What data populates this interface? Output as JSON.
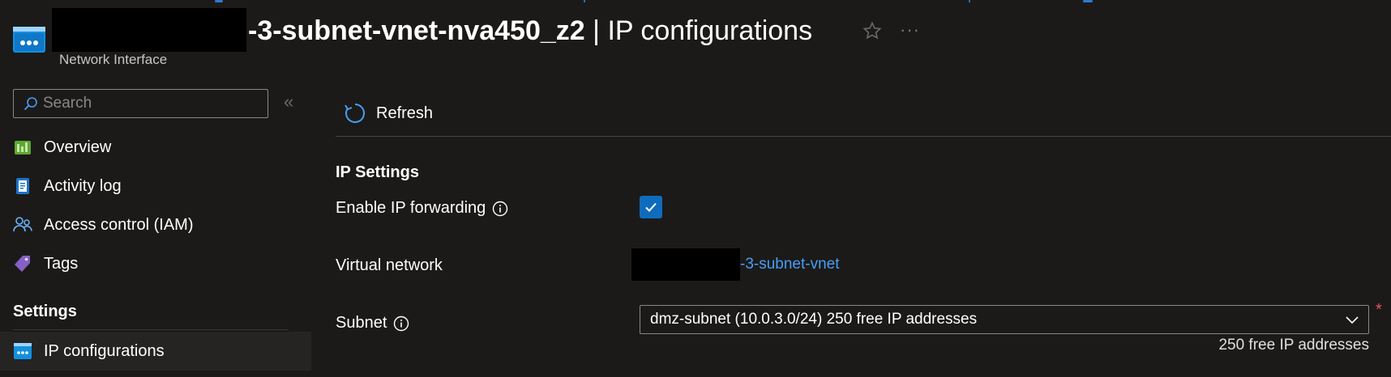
{
  "header": {
    "resource_name": "-3-subnet-vnet-nva450_z2",
    "separator": "|",
    "page_name": "IP configurations",
    "resource_type": "Network Interface",
    "more_label": "···"
  },
  "sidebar": {
    "search_placeholder": "Search",
    "collapse_label": "«",
    "items": [
      {
        "label": "Overview",
        "icon": "overview-icon"
      },
      {
        "label": "Activity log",
        "icon": "activity-log-icon"
      },
      {
        "label": "Access control (IAM)",
        "icon": "people-icon"
      },
      {
        "label": "Tags",
        "icon": "tag-icon"
      }
    ],
    "section_title": "Settings",
    "settings_items": [
      {
        "label": "IP configurations",
        "icon": "network-interface-icon",
        "active": true
      }
    ]
  },
  "toolbar": {
    "refresh_label": "Refresh"
  },
  "ip_settings": {
    "title": "IP Settings",
    "enable_forwarding_label": "Enable IP forwarding",
    "enable_forwarding_checked": true,
    "virtual_network_label": "Virtual network",
    "virtual_network_value": "-3-subnet-vnet",
    "subnet_label": "Subnet",
    "subnet_value": "dmz-subnet (10.0.3.0/24) 250 free IP addresses",
    "subnet_required_mark": "*",
    "subnet_hint": "250 free IP addresses"
  },
  "colors": {
    "background": "#1b1a19",
    "accent": "#0f6cbd",
    "link": "#479ef5",
    "required": "#e0585e"
  }
}
